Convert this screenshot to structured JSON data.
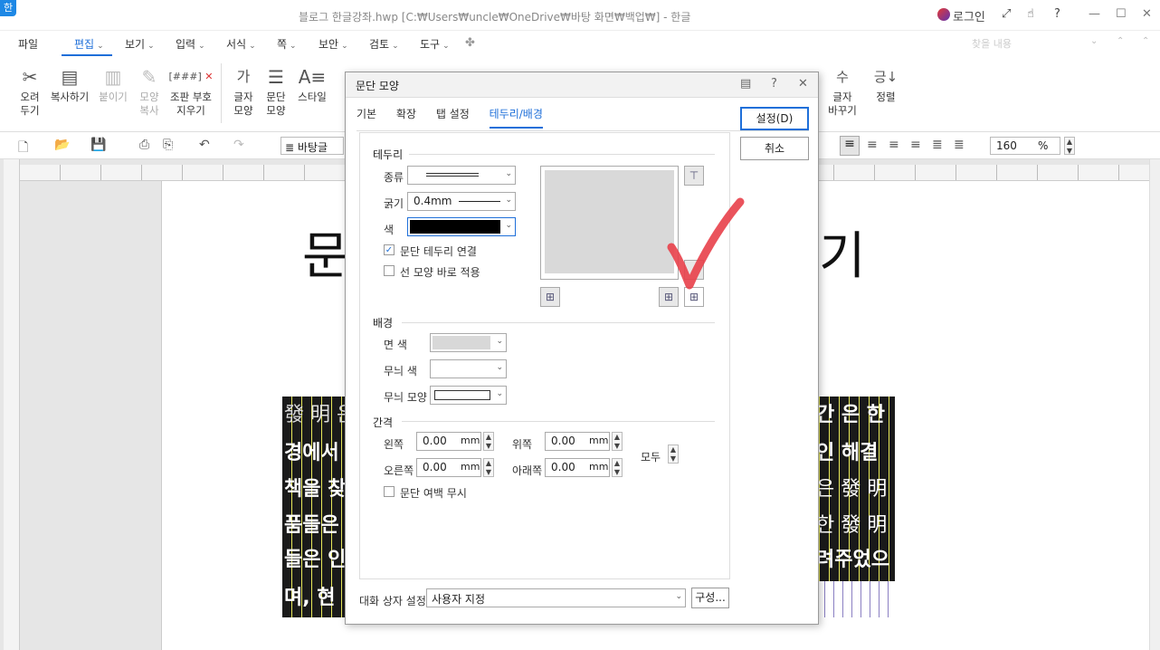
{
  "titlebar": {
    "logo": "한",
    "title": "블로그 한글강좌.hwp [C:₩Users₩uncle₩OneDrive₩바탕 화면₩백업₩] - 한글",
    "login": "로그인",
    "help": "?",
    "min": "—",
    "max": "☐",
    "close": "✕"
  },
  "menubar": {
    "items": [
      "파일",
      "편집",
      "보기",
      "입력",
      "서식",
      "쪽",
      "보안",
      "검토",
      "도구"
    ],
    "search_placeholder": "찾을 내용"
  },
  "ribbon": {
    "cut": "오려\n두기",
    "copy": "복사하기",
    "paste": "붙이기",
    "format_copy": "모양\n복사",
    "clear_code": "조판 부호\n지우기",
    "char_shape": "글자\n모양",
    "para_shape": "문단\n모양",
    "style": "스타일",
    "char_change": "글자\n바꾸기",
    "align": "정렬",
    "code_icon_text": "[###]"
  },
  "toolbar2": {
    "style_value": "바탕글",
    "zoom_value": "160",
    "zoom_unit": "%"
  },
  "document": {
    "title_left": "문",
    "title_right": "기",
    "box_lines": [
      {
        "left": "發 明 은",
        "right": "간 은  한"
      },
      {
        "left": "경에서",
        "right": "인  해결"
      },
      {
        "left": "책을  찾",
        "right": "은  發 明"
      },
      {
        "left": "품들은",
        "right": "한  發 明"
      },
      {
        "left": "들은  인",
        "right": "려주었으"
      },
      {
        "left": "며,  현",
        "right": ""
      }
    ]
  },
  "dialog": {
    "title": "문단 모양",
    "help": "?",
    "close": "✕",
    "tabs": [
      "기본",
      "확장",
      "탭 설정",
      "테두리/배경"
    ],
    "active_tab": "테두리/배경",
    "border": {
      "heading": "테두리",
      "type_label": "종류",
      "thickness_label": "굵기",
      "thickness_value": "0.4mm",
      "color_label": "색",
      "color_value": "#000000",
      "connect_label": "문단 테두리 연결",
      "connect_checked": true,
      "apply_label": "선 모양 바로 적용",
      "apply_checked": false
    },
    "background": {
      "heading": "배경",
      "face_color_label": "면 색",
      "face_color": "#d8d8d8",
      "pattern_color_label": "무늬 색",
      "pattern_color": "#ffffff",
      "pattern_shape_label": "무늬 모양"
    },
    "spacing": {
      "heading": "간격",
      "left_label": "왼쪽",
      "left_value": "0.00",
      "right_label": "오른쪽",
      "right_value": "0.00",
      "top_label": "위쪽",
      "top_value": "0.00",
      "bottom_label": "아래쪽",
      "bottom_value": "0.00",
      "unit": "mm",
      "all_label": "모두",
      "ignore_label": "문단 여백 무시",
      "ignore_checked": false
    },
    "footer": {
      "setting_label": "대화 상자 설정",
      "setting_value": "사용자 지정",
      "compose_label": "구성..."
    },
    "ok_label": "설정(D)",
    "cancel_label": "취소"
  },
  "colors": {
    "accent": "#1e6fd9",
    "checkmark": "#e8404a"
  }
}
